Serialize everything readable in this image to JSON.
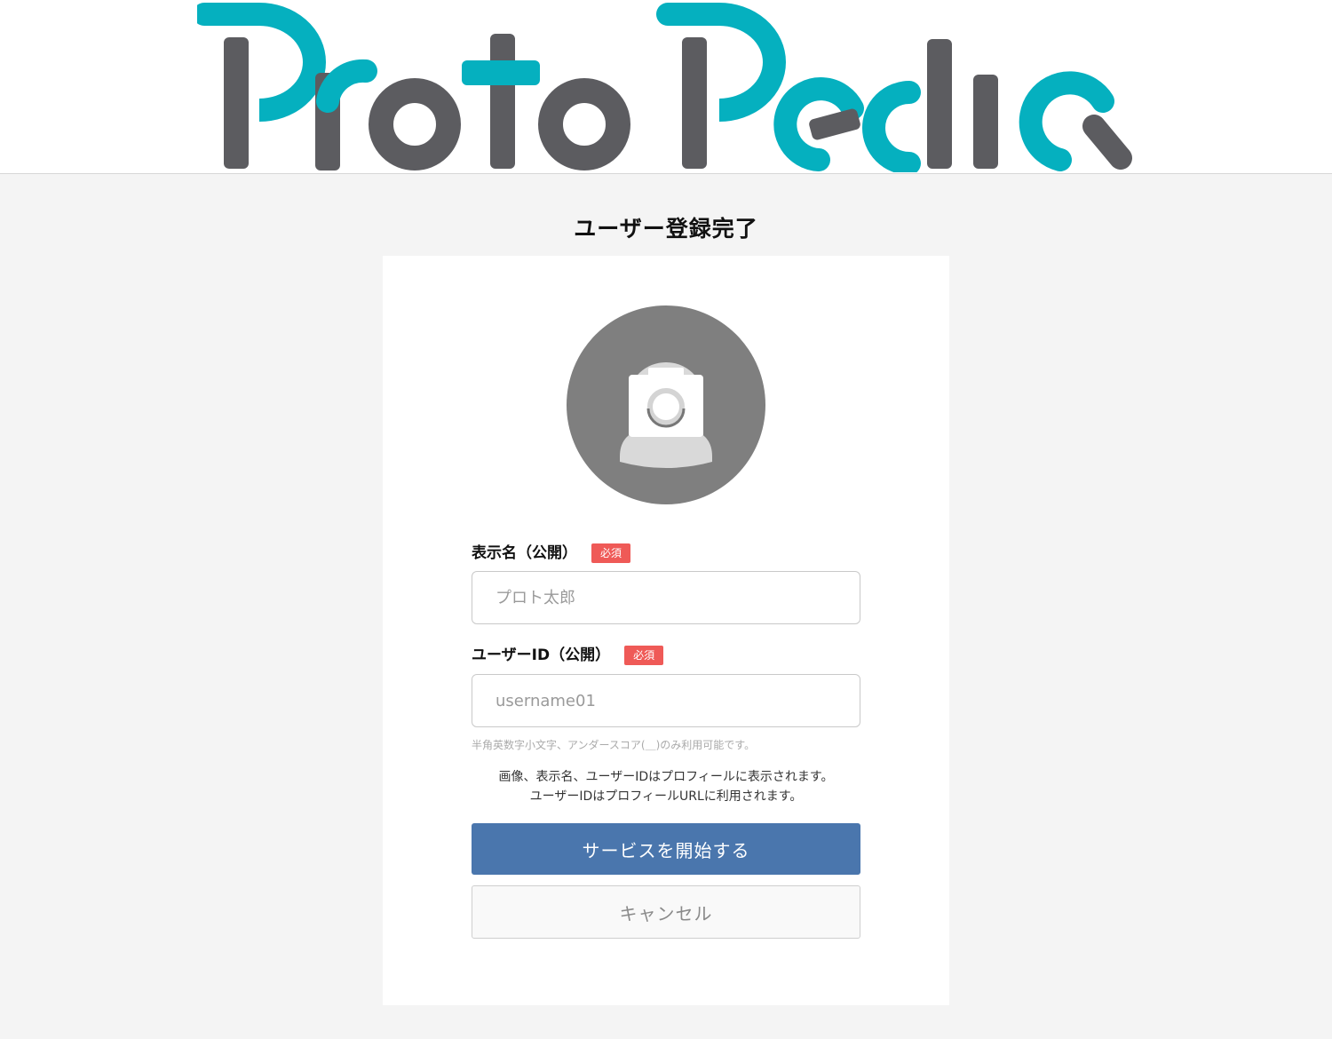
{
  "header": {
    "logo_text": "ProtoPedia",
    "brand_colors": {
      "teal": "#05b0bf",
      "gray": "#5c5c60"
    }
  },
  "page": {
    "title": "ユーザー登録完了"
  },
  "avatar": {
    "icon": "camera-icon",
    "background": "#7f7f7f"
  },
  "form": {
    "display_name": {
      "label": "表示名（公開）",
      "required_badge": "必須",
      "value": "",
      "placeholder": "プロト太郎"
    },
    "user_id": {
      "label": "ユーザーID（公開）",
      "required_badge": "必須",
      "value": "",
      "placeholder": "username01",
      "hint": "半角英数字小文字、アンダースコア(＿)のみ利用可能です。"
    },
    "notice_line1": "画像、表示名、ユーザーIDはプロフィールに表示されます。",
    "notice_line2": "ユーザーIDはプロフィールURLに利用されます。"
  },
  "actions": {
    "start_label": "サービスを開始する",
    "cancel_label": "キャンセル",
    "primary_color": "#4a76ad",
    "badge_color": "#ef5a57"
  }
}
